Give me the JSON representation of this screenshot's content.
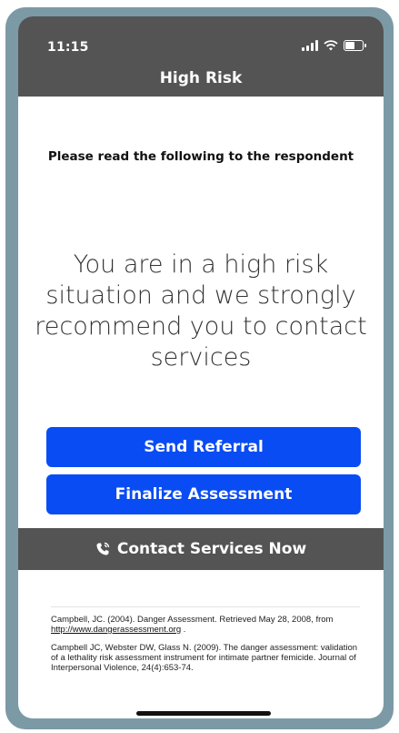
{
  "status_bar": {
    "time": "11:15",
    "signal_icon": "signal-bars-icon",
    "wifi_icon": "wifi-icon",
    "battery_icon": "battery-icon"
  },
  "header": {
    "title": "High Risk"
  },
  "instruction": "Please read the following to the respondent",
  "warning_text": "You are in a high risk situation and we strongly recommend you to contact services",
  "buttons": {
    "send_referral": "Send Referral",
    "finalize_assessment": "Finalize Assessment"
  },
  "contact_bar": {
    "icon": "phone-icon",
    "label": "Contact Services Now"
  },
  "references": [
    {
      "before": "Campbell, JC.  (2004).  Danger Assessment.  Retrieved May 28, 2008, from ",
      "link": "http://www.dangerassessment.org",
      "after": " ."
    },
    {
      "before": "Campbell JC, Webster DW, Glass N.  (2009). The danger assessment: validation of a lethality risk assessment instrument for intimate partner femicide.  Journal of Interpersonal Violence, 24(4):653-74.",
      "link": "",
      "after": ""
    }
  ],
  "colors": {
    "header_bg": "#545454",
    "accent_blue": "#0a4cf3",
    "bezel": "#7b9aa6"
  }
}
